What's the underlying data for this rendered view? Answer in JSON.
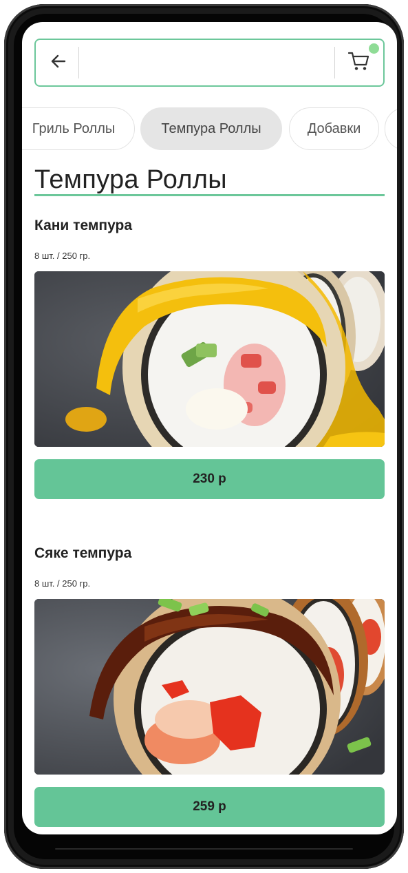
{
  "search": {
    "placeholder": "",
    "value": ""
  },
  "icons": {
    "back": "arrow-left-icon",
    "cart": "shopping-cart-icon",
    "cart_badge_color": "#8fdc96"
  },
  "categories": [
    {
      "label": "Гриль Роллы",
      "active": false
    },
    {
      "label": "Темпура Роллы",
      "active": true
    },
    {
      "label": "Добавки",
      "active": false
    },
    {
      "label": "",
      "active": false
    }
  ],
  "section": {
    "title": "Темпура Роллы"
  },
  "products": [
    {
      "name": "Кани темпура",
      "meta": "8 шт. / 250 гр.",
      "price": "230 р"
    },
    {
      "name": "Сяке темпура",
      "meta": "8 шт. / 250 гр.",
      "price": "259 р"
    }
  ],
  "colors": {
    "accent": "#6cc79a",
    "price_button": "#64c597",
    "active_chip": "#e5e5e5"
  }
}
